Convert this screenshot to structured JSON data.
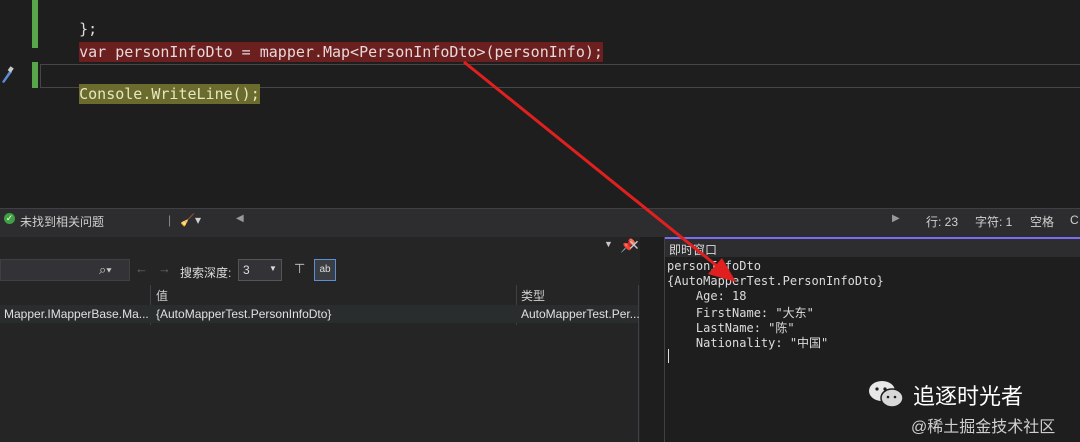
{
  "editor": {
    "lines": [
      {
        "text": "};"
      },
      {
        "text": "var personInfoDto = mapper.Map<PersonInfoDto>(personInfo);"
      },
      {
        "text": "Console.WriteLine();"
      }
    ]
  },
  "status_bar": {
    "issues_text": "未找到相关问题",
    "line": "行: 23",
    "char": "字符: 1",
    "space": "空格",
    "encoding_partial": "C"
  },
  "locals": {
    "search_depth_label": "搜索深度:",
    "search_depth_value": "3",
    "columns": [
      "值",
      "类型"
    ],
    "rows": [
      {
        "name": "Mapper.IMapperBase.Ma...",
        "value": "{AutoMapperTest.PersonInfoDto}",
        "type": "AutoMapperTest.Per..."
      }
    ]
  },
  "immediate": {
    "title": "即时窗口",
    "lines": [
      "personInfoDto",
      "{AutoMapperTest.PersonInfoDto}",
      "    Age: 18",
      "    FirstName: \"大东\"",
      "    LastName: \"陈\"",
      "    Nationality: \"中国\""
    ]
  },
  "watermark": {
    "account": "追逐时光者",
    "site": "@稀土掘金技术社区"
  },
  "colors": {
    "annotation_arrow": "#e0201e",
    "breakpoint_highlight": "#6b1f1f",
    "exec_highlight": "#6b6b2e",
    "immediate_accent": "#7a6df0"
  }
}
